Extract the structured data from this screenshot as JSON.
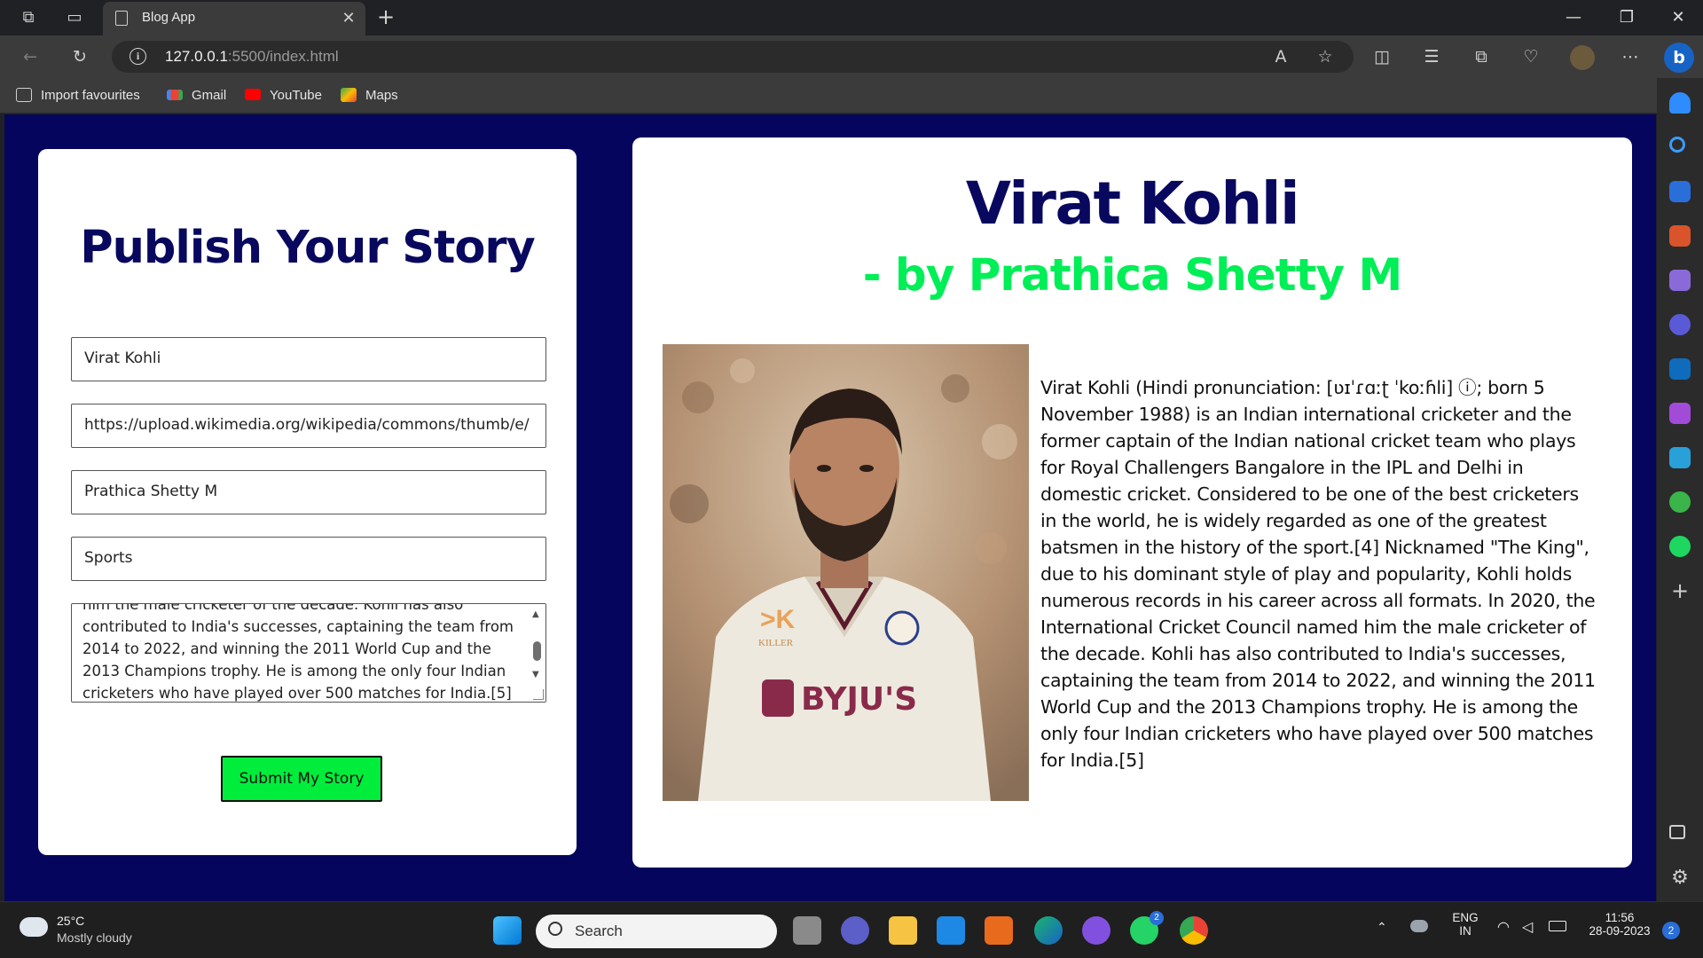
{
  "browser": {
    "tab_title": "Blog App",
    "url_host": "127.0.0.1",
    "url_path": ":5500/index.html",
    "favourites": [
      {
        "label": "Import favourites",
        "icon": "import-icon"
      },
      {
        "label": "Gmail",
        "icon": "gmail-icon"
      },
      {
        "label": "YouTube",
        "icon": "youtube-icon"
      },
      {
        "label": "Maps",
        "icon": "maps-icon"
      }
    ]
  },
  "publish_form": {
    "heading": "Publish Your Story",
    "title_value": "Virat Kohli",
    "image_url_value": "https://upload.wikimedia.org/wikipedia/commons/thumb/e/",
    "author_value": "Prathica Shetty M",
    "category_value": "Sports",
    "story_value": "him the male cricketer of the decade. Kohli has also contributed to India's successes, captaining the team from 2014 to 2022, and winning the 2011 World Cup and the 2013 Champions trophy. He is among the only four Indian cricketers who have played over 500 matches for India.[5]",
    "submit_label": "Submit My Story"
  },
  "story": {
    "title": "Virat Kohli",
    "author_prefix": "- by ",
    "author": "Prathica Shetty M",
    "body": "Virat Kohli (Hindi pronunciation: [ʋɪˈɾɑːʈ ˈkoːɦli] ⓘ; born 5 November 1988) is an Indian international cricketer and the former captain of the Indian national cricket team who plays for Royal Challengers Bangalore in the IPL and Delhi in domestic cricket. Considered to be one of the best cricketers in the world, he is widely regarded as one of the greatest batsmen in the history of the sport.[4] Nicknamed \"The King\", due to his dominant style of play and popularity, Kohli holds numerous records in his career across all formats. In 2020, the International Cricket Council named him the male cricketer of the decade. Kohli has also contributed to India's successes, captaining the team from 2014 to 2022, and winning the 2011 World Cup and the 2013 Champions trophy. He is among the only four Indian cricketers who have played over 500 matches for India.[5]",
    "photo_text": {
      "jersey_brand": "BYJU'S",
      "killer_logo": "KILLER"
    }
  },
  "taskbar": {
    "weather_temp": "25°C",
    "weather_desc": "Mostly cloudy",
    "search_label": "Search",
    "lang_top": "ENG",
    "lang_bottom": "IN",
    "time": "11:56",
    "date": "28-09-2023",
    "notification_count": "2",
    "whatsapp_badge": "2"
  },
  "colors": {
    "page_bg": "#05055d",
    "heading": "#08085e",
    "author": "#00ee56",
    "submit_bg": "#00ee3b"
  }
}
